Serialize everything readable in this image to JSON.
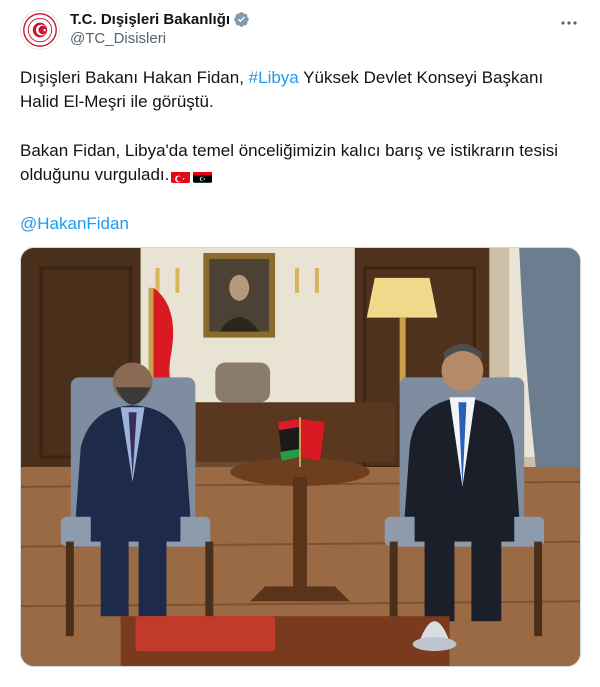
{
  "account": {
    "display_name": "T.C. Dışişleri Bakanlığı",
    "handle": "@TC_Disisleri",
    "avatar_icon": "ministry-seal-icon",
    "verified_icon": "verified-badge-icon",
    "verified_color": "#829aab"
  },
  "tweet": {
    "line1_pre": "Dışişleri Bakanı Hakan Fidan, ",
    "line1_hashtag": "#Libya",
    "line1_post": " Yüksek Devlet Konseyi Başkanı Halid El-Meşri ile görüştü.",
    "line2": "Bakan Fidan, Libya'da temel önceliğimizin kalıcı barış ve istikrarın tesisi olduğunu vurguladı.",
    "flags": [
      "turkey-flag-icon",
      "libya-flag-icon"
    ],
    "mention": "@HakanFidan"
  },
  "media": {
    "type": "photo",
    "description_icon": "meeting-photo"
  },
  "colors": {
    "link": "#1d9bf0",
    "text": "#0f1419",
    "secondary": "#536471"
  },
  "menu": {
    "more_icon": "more-options-icon"
  }
}
